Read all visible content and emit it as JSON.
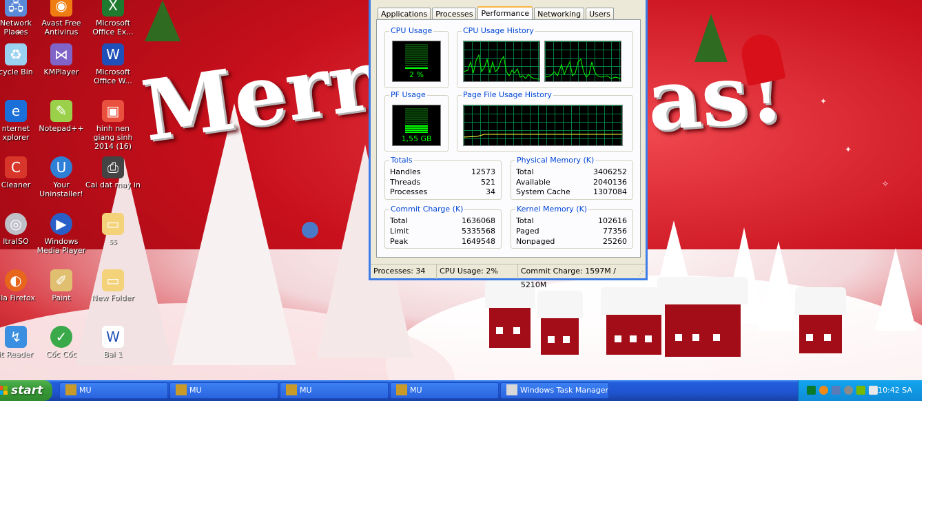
{
  "desktop": {
    "icons": [
      {
        "label": "Network Places",
        "icon": "network-places-icon"
      },
      {
        "label": "Avast Free Antivirus",
        "icon": "avast-icon"
      },
      {
        "label": "Microsoft Office Ex...",
        "icon": "excel-icon"
      },
      {
        "label": "cycle Bin",
        "icon": "recycle-bin-icon"
      },
      {
        "label": "KMPlayer",
        "icon": "kmplayer-icon"
      },
      {
        "label": "Microsoft Office W...",
        "icon": "word-icon"
      },
      {
        "label": "nternet xplorer",
        "icon": "internet-explorer-icon"
      },
      {
        "label": "Notepad++",
        "icon": "notepad-plus-icon"
      },
      {
        "label": "hinh nen giang sinh 2014 (16)",
        "icon": "image-file-icon"
      },
      {
        "label": "Cleaner",
        "icon": "ccleaner-icon"
      },
      {
        "label": "Your Uninstaller!",
        "icon": "uninstaller-icon"
      },
      {
        "label": "Cai dat may in",
        "icon": "printer-icon"
      },
      {
        "label": "ltraISO",
        "icon": "ultraiso-icon"
      },
      {
        "label": "Windows Media Player",
        "icon": "media-player-icon"
      },
      {
        "label": "ss",
        "icon": "folder-icon"
      },
      {
        "label": "illa Firefox",
        "icon": "firefox-icon"
      },
      {
        "label": "Paint",
        "icon": "paint-icon"
      },
      {
        "label": "New Folder",
        "icon": "folder-icon"
      },
      {
        "label": "it Reader",
        "icon": "reader-icon"
      },
      {
        "label": "Cốc Cốc",
        "icon": "coccoc-icon"
      },
      {
        "label": "Bai 1",
        "icon": "word-doc-icon"
      }
    ],
    "wallpaper_text": "Merry ch",
    "wallpaper_text2": "as!"
  },
  "taskmgr": {
    "tabs": [
      "Applications",
      "Processes",
      "Performance",
      "Networking",
      "Users"
    ],
    "active_tab": "Performance",
    "cpu_usage": {
      "legend": "CPU Usage",
      "value": "2 %",
      "level": 0.02
    },
    "cpu_history": {
      "legend": "CPU Usage History"
    },
    "pf_usage": {
      "legend": "PF Usage",
      "value": "1,55 GB",
      "level": 0.31
    },
    "pf_history": {
      "legend": "Page File Usage History"
    },
    "totals": {
      "legend": "Totals",
      "rows": [
        {
          "label": "Handles",
          "value": "12573"
        },
        {
          "label": "Threads",
          "value": "521"
        },
        {
          "label": "Processes",
          "value": "34"
        }
      ]
    },
    "physical_memory": {
      "legend": "Physical Memory (K)",
      "rows": [
        {
          "label": "Total",
          "value": "3406252"
        },
        {
          "label": "Available",
          "value": "2040136"
        },
        {
          "label": "System Cache",
          "value": "1307084"
        }
      ]
    },
    "commit_charge": {
      "legend": "Commit Charge (K)",
      "rows": [
        {
          "label": "Total",
          "value": "1636068"
        },
        {
          "label": "Limit",
          "value": "5335568"
        },
        {
          "label": "Peak",
          "value": "1649548"
        }
      ]
    },
    "kernel_memory": {
      "legend": "Kernel Memory (K)",
      "rows": [
        {
          "label": "Total",
          "value": "102616"
        },
        {
          "label": "Paged",
          "value": "77356"
        },
        {
          "label": "Nonpaged",
          "value": "25260"
        }
      ]
    },
    "status": {
      "processes": "Processes: 34",
      "cpu": "CPU Usage: 2%",
      "commit": "Commit Charge: 1597M / 5210M"
    }
  },
  "taskbar": {
    "start_label": "start",
    "buttons": [
      {
        "label": "MU",
        "icon": "mu-game-icon"
      },
      {
        "label": "MU",
        "icon": "mu-game-icon"
      },
      {
        "label": "MU",
        "icon": "mu-game-icon"
      },
      {
        "label": "MU",
        "icon": "mu-game-icon"
      },
      {
        "label": "Windows Task Manager",
        "icon": "task-manager-icon"
      }
    ],
    "clock": "10:42 SA"
  },
  "colors": {
    "xp_blue": "#245edb",
    "start_green": "#3a9a39",
    "tray_blue": "#0f8bd8",
    "graph_green": "#00ff00",
    "legend_blue": "#0046d5"
  }
}
